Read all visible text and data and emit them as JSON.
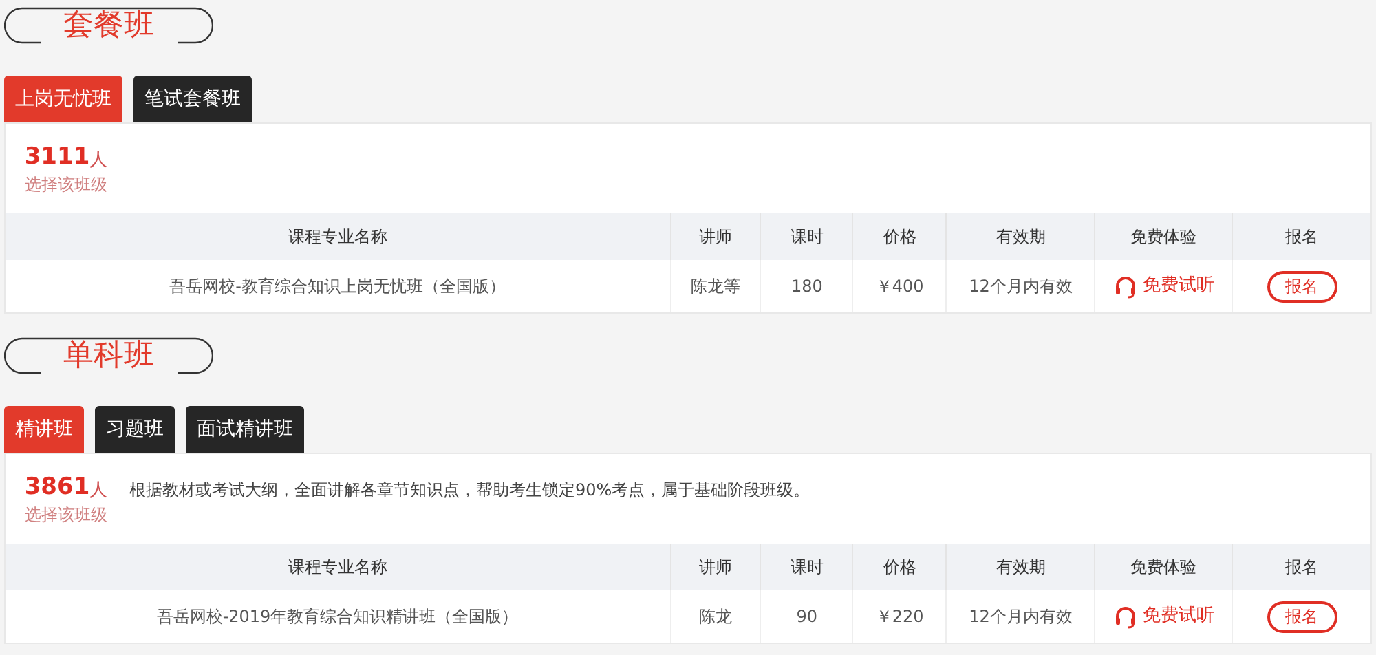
{
  "sections": [
    {
      "title": "套餐班",
      "tabs": [
        {
          "label": "上岗无忧班",
          "selected": true
        },
        {
          "label": "笔试套餐班",
          "selected": false
        }
      ],
      "count": "3111",
      "count_unit": "人",
      "count_caption": "选择该班级",
      "columns": [
        "课程专业名称",
        "讲师",
        "课时",
        "价格",
        "有效期",
        "免费体验",
        "报名"
      ],
      "rows": [
        {
          "name": "吾岳网校-教育综合知识上岗无忧班（全国版）",
          "teacher": "陈龙等",
          "hours": "180",
          "price": "￥400",
          "validity": "12个月内有效",
          "trial": "免费试听",
          "enroll": "报名"
        }
      ]
    },
    {
      "title": "单科班",
      "tabs": [
        {
          "label": "精讲班",
          "selected": true
        },
        {
          "label": "习题班",
          "selected": false
        },
        {
          "label": "面试精讲班",
          "selected": false
        }
      ],
      "count": "3861",
      "count_unit": "人",
      "count_caption": "选择该班级",
      "description": "根据教材或考试大纲，全面讲解各章节知识点，帮助考生锁定90%考点，属于基础阶段班级。",
      "columns": [
        "课程专业名称",
        "讲师",
        "课时",
        "价格",
        "有效期",
        "免费体验",
        "报名"
      ],
      "rows": [
        {
          "name": "吾岳网校-2019年教育综合知识精讲班（全国版）",
          "teacher": "陈龙",
          "hours": "90",
          "price": "￥220",
          "validity": "12个月内有效",
          "trial": "免费试听",
          "enroll": "报名"
        }
      ]
    }
  ]
}
